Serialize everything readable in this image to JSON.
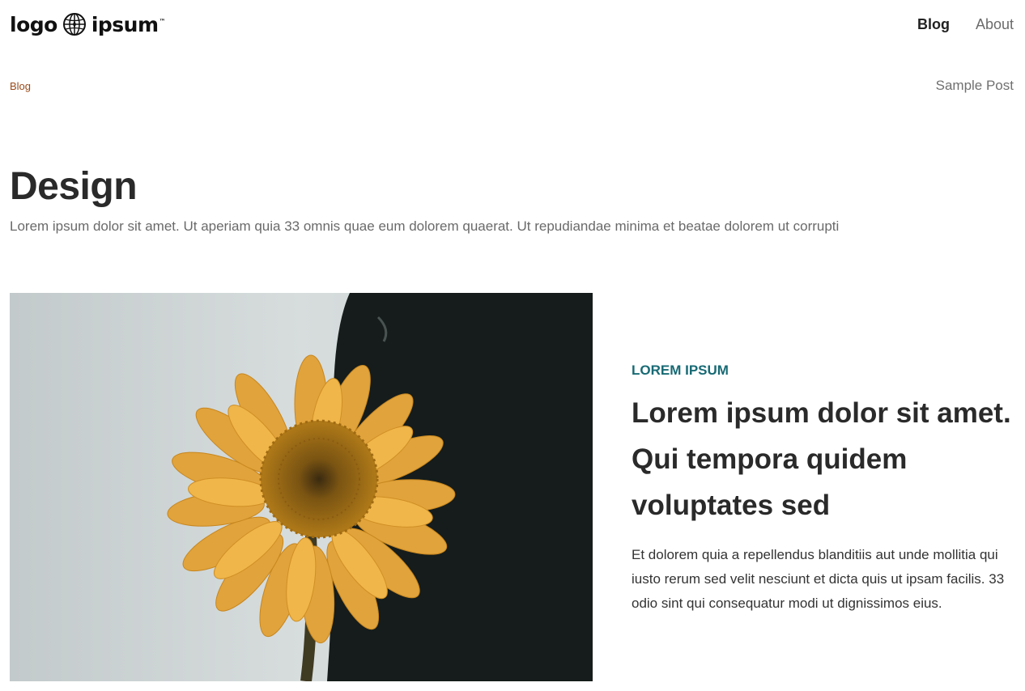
{
  "header": {
    "logo": {
      "word1": "logo",
      "word2": "ipsum",
      "tm": "™",
      "icon": "globe-icon"
    },
    "nav": [
      {
        "label": "Blog",
        "active": true
      },
      {
        "label": "About",
        "active": false
      }
    ]
  },
  "breadcrumb": {
    "parent": "Blog",
    "current": "Sample Post"
  },
  "category": {
    "title": "Design",
    "description": "Lorem ipsum dolor sit amet. Ut aperiam quia 33 omnis quae eum dolorem quaerat. Ut repudiandae minima et beatae dolorem ut corrupti"
  },
  "featured": {
    "image": "sunflower-photo",
    "tag": "LOREM IPSUM",
    "title": "Lorem ipsum dolor sit amet. Qui tempora quidem voluptates sed",
    "excerpt": "Et dolorem quia a repellendus blanditiis aut unde mollitia qui iusto rerum sed velit nesciunt et dicta quis ut ipsam facilis. 33 odio sint qui consequatur modi ut dignissimos eius."
  },
  "colors": {
    "accent_tag": "#176a74",
    "breadcrumb_link": "#9a4a1a",
    "text_dark": "#2a2a2a",
    "text_muted": "#6a6a6a"
  }
}
